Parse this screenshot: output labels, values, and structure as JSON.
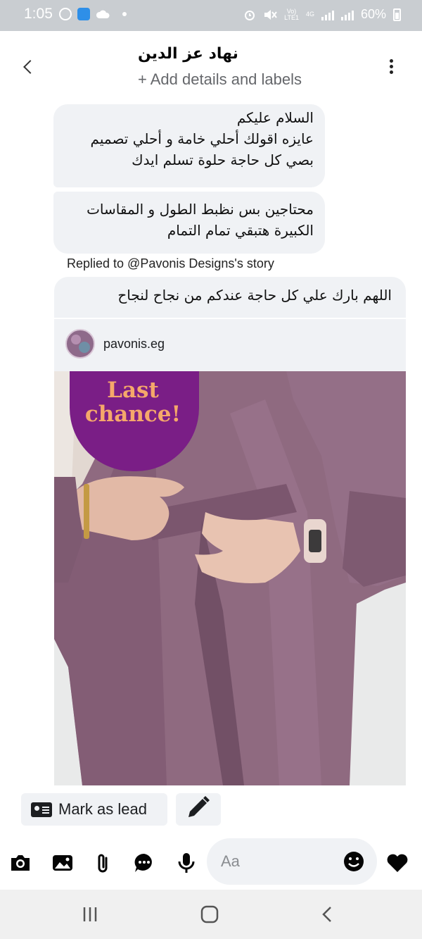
{
  "status_bar": {
    "time": "1:05",
    "battery": "60%",
    "network_top": "Vo)",
    "network_bottom": "LTE1",
    "network_type": "4G",
    "left_icons": [
      "whatsapp-icon",
      "app-icon",
      "cloud-icon",
      "dot-icon"
    ],
    "right_icons": [
      "alarm-icon",
      "mute-icon",
      "signal-icon",
      "signal-icon",
      "battery-icon"
    ]
  },
  "header": {
    "contact_name": "نهاد عز الدين",
    "add_details_label": "+ Add details and labels",
    "icons": [
      "back-chevron-icon",
      "more-vertical-icon"
    ]
  },
  "messages": [
    {
      "lines": [
        "السلام عليكم",
        "عايزه اقولك أحلي خامة و أحلي تصميم",
        "بصي كل حاجة حلوة تسلم ايدك"
      ]
    },
    {
      "lines": [
        "محتاجين بس نظبط الطول و المقاسات",
        "الكبيرة هتبقي تمام التمام"
      ]
    }
  ],
  "story_reply": {
    "caption": "Replied to @Pavonis Designs's story",
    "message": "اللهم بارك علي كل حاجة عندكم من نجاح لنجاح",
    "account_handle": "pavonis.eg",
    "promo_line1": "Last",
    "promo_line2": "chance!"
  },
  "actions": {
    "mark_as_lead_label": "Mark as lead",
    "icons": [
      "lead-card-icon",
      "pencil-icon"
    ]
  },
  "composer": {
    "placeholder": "Aa",
    "icons": [
      "camera-icon",
      "gallery-icon",
      "attachment-icon",
      "chat-bubble-icon",
      "microphone-icon",
      "emoji-icon",
      "heart-icon"
    ]
  },
  "nav_bar": {
    "icons": [
      "recents-icon",
      "home-icon",
      "back-icon"
    ]
  },
  "colors": {
    "status_bar_bg": "#c9cdd1",
    "bubble_bg": "#f0f2f5",
    "text_secondary": "#65676b",
    "promo_purple": "#7a1e86",
    "promo_text": "#f5a86a",
    "dress_mauve": "#8f6a80"
  }
}
